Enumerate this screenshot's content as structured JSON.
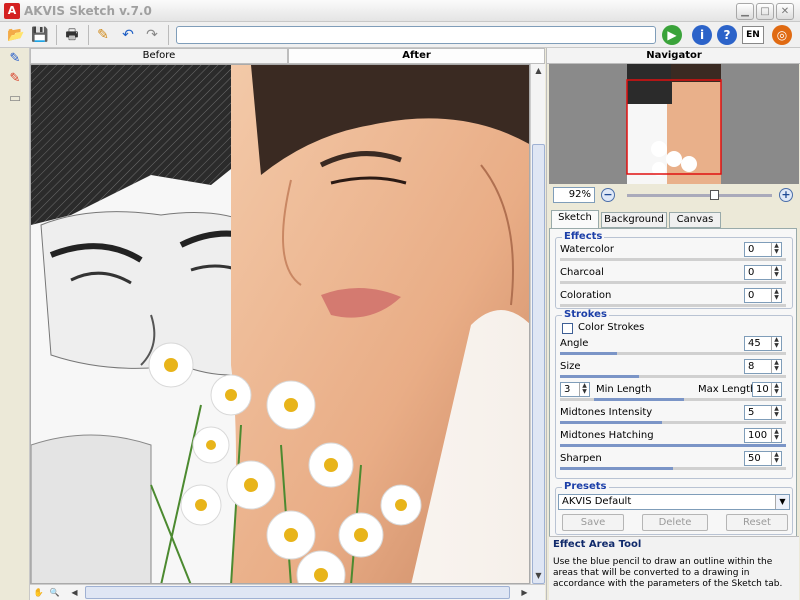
{
  "window": {
    "title": "AKVIS Sketch v.7.0",
    "logo": "A",
    "controls": [
      "minimize-icon",
      "maximize-icon",
      "close-icon"
    ]
  },
  "toolbar": {
    "icons": [
      "open-icon",
      "save-icon",
      "print-icon",
      "pencil-icon",
      "undo-icon",
      "redo-icon"
    ],
    "path_value": "",
    "run_icon": "run-icon",
    "info_icon": "info-icon",
    "help_icon": "help-icon",
    "language": "EN",
    "settings_icon": "settings-icon"
  },
  "tools": [
    "blue-pencil-icon",
    "red-pencil-icon",
    "eraser-icon"
  ],
  "view_tabs": {
    "before": "Before",
    "after": "After",
    "active": "after"
  },
  "navigator": {
    "title": "Navigator",
    "zoom": "92%",
    "zoom_level": 0.6
  },
  "param_tabs": [
    "Sketch",
    "Background",
    "Canvas"
  ],
  "effects": {
    "title": "Effects",
    "items": [
      {
        "label": "Watercolor",
        "value": "0",
        "fraction": 0
      },
      {
        "label": "Charcoal",
        "value": "0",
        "fraction": 0
      },
      {
        "label": "Coloration",
        "value": "0",
        "fraction": 0
      }
    ]
  },
  "strokes": {
    "title": "Strokes",
    "color_strokes_label": "Color Strokes",
    "color_strokes_checked": false,
    "angle": {
      "label": "Angle",
      "value": "45",
      "fraction": 0.25
    },
    "size": {
      "label": "Size",
      "value": "8",
      "fraction": 0.35
    },
    "min_length_label": "Min Length",
    "min_length": "3",
    "max_length_label": "Max Length",
    "max_length": "10",
    "midtones_intensity": {
      "label": "Midtones Intensity",
      "value": "5",
      "fraction": 0.45
    },
    "midtones_hatching": {
      "label": "Midtones Hatching",
      "value": "100",
      "fraction": 1.0
    },
    "sharpen": {
      "label": "Sharpen",
      "value": "50",
      "fraction": 0.5
    }
  },
  "presets": {
    "title": "Presets",
    "selected": "AKVIS Default",
    "save_label": "Save",
    "delete_label": "Delete",
    "reset_label": "Reset"
  },
  "help": {
    "title": "Effect Area Tool",
    "text": "Use the blue pencil to draw an outline within the areas that will be converted to a drawing in accordance with the parameters of the Sketch tab."
  }
}
